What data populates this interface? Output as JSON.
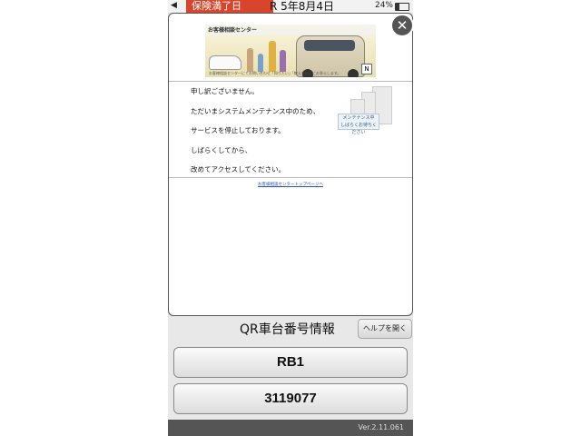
{
  "status_bar": {
    "back_label": "◀",
    "left_text": "保険満了日",
    "date_text": "R 5年8月4日",
    "battery": "24%"
  },
  "maintenance": {
    "banner_title": "お客様相談センター",
    "banner_text": "お客様相談センターにてお問い合わせ「知りたい」「教えたい」にお答えします。",
    "messages": [
      "申し訳ございません。",
      "ただいまシステムメンテナンス中のため、",
      "サービスを停止しております。",
      "しばらくしてから、",
      "改めてアクセスしてください。"
    ],
    "maintenance_label": "メンテナンス中",
    "maintenance_sub": "しばらくお待ちください",
    "top_link": "お客様相談センタートップページへ",
    "close_symbol": "✕"
  },
  "qr": {
    "title": "QR車台番号情報",
    "help_button": "ヘルプを開く",
    "model": "RB1",
    "serial": "3119077"
  },
  "footer": {
    "version": "Ver.2.11.061"
  }
}
